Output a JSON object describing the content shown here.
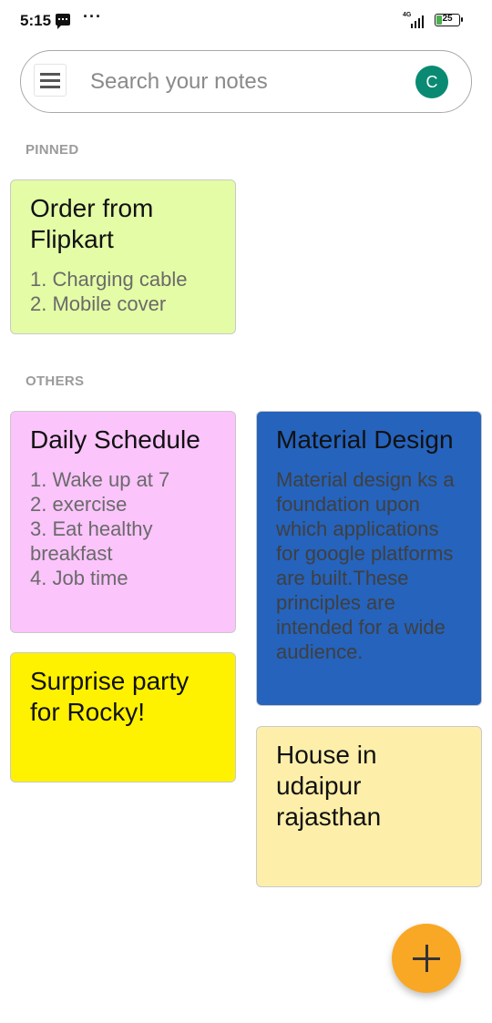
{
  "status_bar": {
    "time": "5:15",
    "network_label": "4G",
    "battery_level": "25",
    "icons": [
      "message-icon",
      "more-dots-icon",
      "signal-icon",
      "battery-icon"
    ]
  },
  "search": {
    "placeholder": "Search your notes",
    "value": "",
    "avatar_initial": "C",
    "avatar_color": "#0a8a73"
  },
  "sections": {
    "pinned": "PINNED",
    "others": "OTHERS"
  },
  "notes": {
    "pinned": [
      {
        "title": "Order from Flipkart",
        "body": "1. Charging cable\n2. Mobile cover",
        "color": "#e4fca6"
      }
    ],
    "others": [
      {
        "title": "Daily Schedule",
        "body": "1. Wake up at 7\n2. exercise\n3. Eat healthy breakfast\n4. Job time",
        "color": "#fbc4fb"
      },
      {
        "title": "Material Design",
        "body": "Material design ks a foundation upon which applications for google platforms are built.These principles are intended for a wide audience.",
        "color": "#2563bd"
      },
      {
        "title": "Surprise party for Rocky!",
        "body": "",
        "color": "#fff200"
      },
      {
        "title": "House in udaipur rajasthan",
        "body": "",
        "color": "#fdefaa"
      }
    ]
  },
  "fab": {
    "icon": "plus-icon",
    "color": "#f9a825"
  }
}
